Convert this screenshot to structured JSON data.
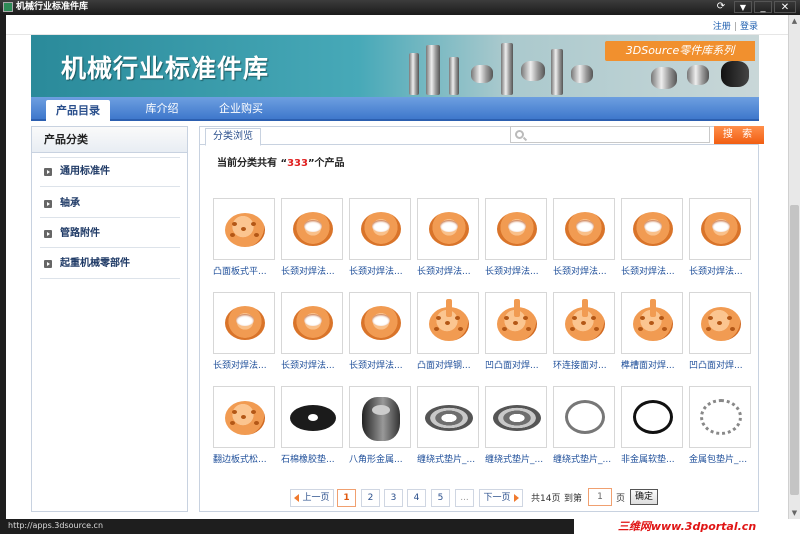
{
  "window": {
    "title": "机械行业标准件库"
  },
  "top_links": {
    "register": "注册",
    "login": "登录"
  },
  "banner": {
    "title": "机械行业标准件库",
    "tag": "3DSource零件库系列"
  },
  "nav": {
    "items": [
      "产品目录",
      "库介绍",
      "企业购买"
    ],
    "active": "产品目录"
  },
  "sidebar": {
    "title": "产品分类",
    "categories": [
      "通用标准件",
      "轴承",
      "管路附件",
      "起重机械零部件"
    ]
  },
  "main": {
    "tab": "分类浏览",
    "search": {
      "placeholder": "",
      "button": "搜 索"
    },
    "count_prefix": "当前分类共有 “",
    "count_value": "333",
    "count_suffix": "”个产品",
    "products": [
      {
        "name": "凸面板式平...",
        "kind": "blind"
      },
      {
        "name": "长颈对焊法...",
        "kind": "flange"
      },
      {
        "name": "长颈对焊法...",
        "kind": "flange"
      },
      {
        "name": "长颈对焊法...",
        "kind": "flange"
      },
      {
        "name": "长颈对焊法...",
        "kind": "flange"
      },
      {
        "name": "长颈对焊法...",
        "kind": "flange"
      },
      {
        "name": "长颈对焊法...",
        "kind": "flange"
      },
      {
        "name": "长颈对焊法...",
        "kind": "flange"
      },
      {
        "name": "长颈对焊法...",
        "kind": "flange"
      },
      {
        "name": "长颈对焊法...",
        "kind": "flange"
      },
      {
        "name": "长颈对焊法...",
        "kind": "flange"
      },
      {
        "name": "凸面对焊钢...",
        "kind": "spike"
      },
      {
        "name": "凹凸面对焊...",
        "kind": "spike"
      },
      {
        "name": "环连接面对...",
        "kind": "spike"
      },
      {
        "name": "榫槽面对焊...",
        "kind": "spike"
      },
      {
        "name": "凹凸面对焊...",
        "kind": "blind"
      },
      {
        "name": "翻边板式松...",
        "kind": "blind"
      },
      {
        "name": "石棉橡胶垫...",
        "kind": "gasket-black"
      },
      {
        "name": "八角形金属...",
        "kind": "octa"
      },
      {
        "name": "缠绕式垫片_...",
        "kind": "spiral"
      },
      {
        "name": "缠绕式垫片_...",
        "kind": "spiral"
      },
      {
        "name": "缠绕式垫片_...",
        "kind": "ring-thin"
      },
      {
        "name": "非金属软垫...",
        "kind": "ring-black"
      },
      {
        "name": "金属包垫片_...",
        "kind": "ring-gray"
      }
    ]
  },
  "pager": {
    "prev": "上一页",
    "pages": [
      "1",
      "2",
      "3",
      "4",
      "5",
      "..."
    ],
    "current": "1",
    "next": "下一页",
    "total": "共14页",
    "goto_label": "到第",
    "goto_value": "1",
    "page_unit": "页",
    "confirm": "确定"
  },
  "status": {
    "url": "http://apps.3dsource.cn",
    "watermark": "三维网www.3dportal.cn"
  },
  "colors": {
    "nav_blue": "#4a82d2",
    "accent_orange": "#f1902e",
    "count_red": "#e02020"
  }
}
